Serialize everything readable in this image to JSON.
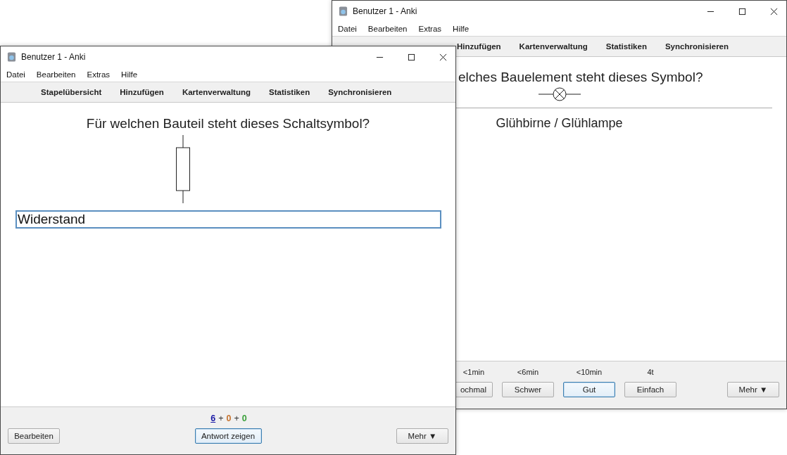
{
  "back_window": {
    "title": "Benutzer 1 - Anki",
    "menu": [
      "Datei",
      "Bearbeiten",
      "Extras",
      "Hilfe"
    ],
    "toolbar": [
      "Hinzufügen",
      "Kartenverwaltung",
      "Statistiken",
      "Synchronisieren"
    ],
    "question": "elches Bauelement steht dieses Symbol?",
    "symbol": {
      "kind": "lamp"
    },
    "answer": "Glühbirne / Glühlampe",
    "ease_buttons": [
      {
        "interval": "<1min",
        "label": "ochmal",
        "focused": false
      },
      {
        "interval": "<6min",
        "label": "Schwer",
        "focused": false
      },
      {
        "interval": "<10min",
        "label": "Gut",
        "focused": true
      },
      {
        "interval": "4t",
        "label": "Einfach",
        "focused": false
      }
    ],
    "more_button": "Mehr ▼"
  },
  "front_window": {
    "title": "Benutzer 1 - Anki",
    "menu": [
      "Datei",
      "Bearbeiten",
      "Extras",
      "Hilfe"
    ],
    "toolbar": [
      "Stapelübersicht",
      "Hinzufügen",
      "Kartenverwaltung",
      "Statistiken",
      "Synchronisieren"
    ],
    "question": "Für welchen Bauteil steht dieses Schaltsymbol?",
    "symbol": {
      "kind": "resistor"
    },
    "answer_input": "Widerstand",
    "counts": [
      {
        "value": "6",
        "color": "#1a1aa6"
      },
      {
        "value": "0",
        "color": "#c5722e"
      },
      {
        "value": "0",
        "color": "#3aa03a"
      }
    ],
    "count_separator": "+",
    "edit_button": "Bearbeiten",
    "show_answer_button": "Antwort zeigen",
    "more_button": "Mehr ▼"
  }
}
